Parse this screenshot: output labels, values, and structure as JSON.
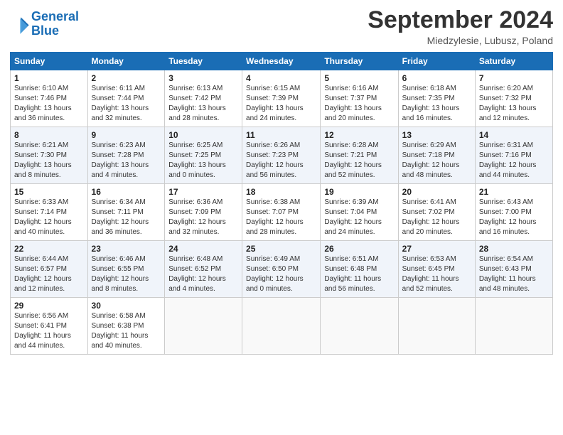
{
  "header": {
    "logo_line1": "General",
    "logo_line2": "Blue",
    "month": "September 2024",
    "location": "Miedzylesie, Lubusz, Poland"
  },
  "days_of_week": [
    "Sunday",
    "Monday",
    "Tuesday",
    "Wednesday",
    "Thursday",
    "Friday",
    "Saturday"
  ],
  "weeks": [
    [
      {
        "day": "1",
        "info": "Sunrise: 6:10 AM\nSunset: 7:46 PM\nDaylight: 13 hours\nand 36 minutes."
      },
      {
        "day": "2",
        "info": "Sunrise: 6:11 AM\nSunset: 7:44 PM\nDaylight: 13 hours\nand 32 minutes."
      },
      {
        "day": "3",
        "info": "Sunrise: 6:13 AM\nSunset: 7:42 PM\nDaylight: 13 hours\nand 28 minutes."
      },
      {
        "day": "4",
        "info": "Sunrise: 6:15 AM\nSunset: 7:39 PM\nDaylight: 13 hours\nand 24 minutes."
      },
      {
        "day": "5",
        "info": "Sunrise: 6:16 AM\nSunset: 7:37 PM\nDaylight: 13 hours\nand 20 minutes."
      },
      {
        "day": "6",
        "info": "Sunrise: 6:18 AM\nSunset: 7:35 PM\nDaylight: 13 hours\nand 16 minutes."
      },
      {
        "day": "7",
        "info": "Sunrise: 6:20 AM\nSunset: 7:32 PM\nDaylight: 13 hours\nand 12 minutes."
      }
    ],
    [
      {
        "day": "8",
        "info": "Sunrise: 6:21 AM\nSunset: 7:30 PM\nDaylight: 13 hours\nand 8 minutes."
      },
      {
        "day": "9",
        "info": "Sunrise: 6:23 AM\nSunset: 7:28 PM\nDaylight: 13 hours\nand 4 minutes."
      },
      {
        "day": "10",
        "info": "Sunrise: 6:25 AM\nSunset: 7:25 PM\nDaylight: 13 hours\nand 0 minutes."
      },
      {
        "day": "11",
        "info": "Sunrise: 6:26 AM\nSunset: 7:23 PM\nDaylight: 12 hours\nand 56 minutes."
      },
      {
        "day": "12",
        "info": "Sunrise: 6:28 AM\nSunset: 7:21 PM\nDaylight: 12 hours\nand 52 minutes."
      },
      {
        "day": "13",
        "info": "Sunrise: 6:29 AM\nSunset: 7:18 PM\nDaylight: 12 hours\nand 48 minutes."
      },
      {
        "day": "14",
        "info": "Sunrise: 6:31 AM\nSunset: 7:16 PM\nDaylight: 12 hours\nand 44 minutes."
      }
    ],
    [
      {
        "day": "15",
        "info": "Sunrise: 6:33 AM\nSunset: 7:14 PM\nDaylight: 12 hours\nand 40 minutes."
      },
      {
        "day": "16",
        "info": "Sunrise: 6:34 AM\nSunset: 7:11 PM\nDaylight: 12 hours\nand 36 minutes."
      },
      {
        "day": "17",
        "info": "Sunrise: 6:36 AM\nSunset: 7:09 PM\nDaylight: 12 hours\nand 32 minutes."
      },
      {
        "day": "18",
        "info": "Sunrise: 6:38 AM\nSunset: 7:07 PM\nDaylight: 12 hours\nand 28 minutes."
      },
      {
        "day": "19",
        "info": "Sunrise: 6:39 AM\nSunset: 7:04 PM\nDaylight: 12 hours\nand 24 minutes."
      },
      {
        "day": "20",
        "info": "Sunrise: 6:41 AM\nSunset: 7:02 PM\nDaylight: 12 hours\nand 20 minutes."
      },
      {
        "day": "21",
        "info": "Sunrise: 6:43 AM\nSunset: 7:00 PM\nDaylight: 12 hours\nand 16 minutes."
      }
    ],
    [
      {
        "day": "22",
        "info": "Sunrise: 6:44 AM\nSunset: 6:57 PM\nDaylight: 12 hours\nand 12 minutes."
      },
      {
        "day": "23",
        "info": "Sunrise: 6:46 AM\nSunset: 6:55 PM\nDaylight: 12 hours\nand 8 minutes."
      },
      {
        "day": "24",
        "info": "Sunrise: 6:48 AM\nSunset: 6:52 PM\nDaylight: 12 hours\nand 4 minutes."
      },
      {
        "day": "25",
        "info": "Sunrise: 6:49 AM\nSunset: 6:50 PM\nDaylight: 12 hours\nand 0 minutes."
      },
      {
        "day": "26",
        "info": "Sunrise: 6:51 AM\nSunset: 6:48 PM\nDaylight: 11 hours\nand 56 minutes."
      },
      {
        "day": "27",
        "info": "Sunrise: 6:53 AM\nSunset: 6:45 PM\nDaylight: 11 hours\nand 52 minutes."
      },
      {
        "day": "28",
        "info": "Sunrise: 6:54 AM\nSunset: 6:43 PM\nDaylight: 11 hours\nand 48 minutes."
      }
    ],
    [
      {
        "day": "29",
        "info": "Sunrise: 6:56 AM\nSunset: 6:41 PM\nDaylight: 11 hours\nand 44 minutes."
      },
      {
        "day": "30",
        "info": "Sunrise: 6:58 AM\nSunset: 6:38 PM\nDaylight: 11 hours\nand 40 minutes."
      },
      {
        "day": "",
        "info": ""
      },
      {
        "day": "",
        "info": ""
      },
      {
        "day": "",
        "info": ""
      },
      {
        "day": "",
        "info": ""
      },
      {
        "day": "",
        "info": ""
      }
    ]
  ]
}
